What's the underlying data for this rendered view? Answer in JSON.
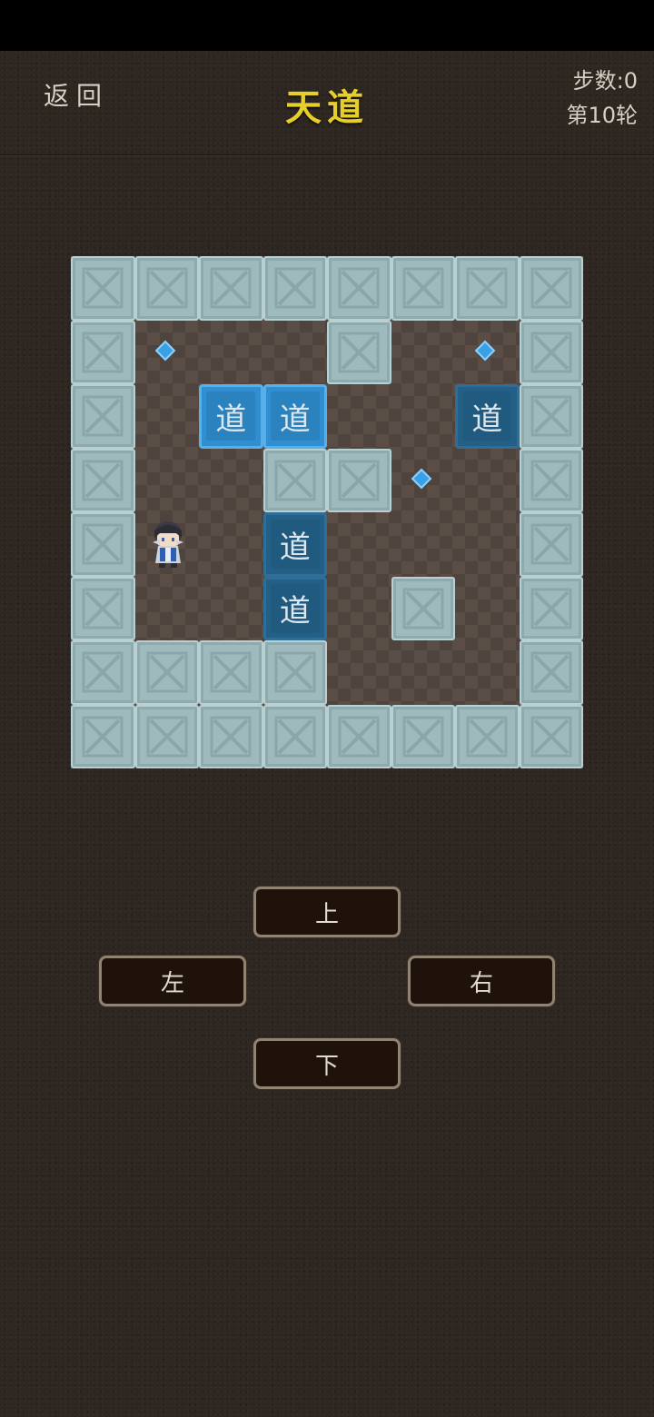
{
  "header": {
    "back_label": "返回",
    "title": "天道",
    "steps_label": "步数:0",
    "round_label": "第10轮"
  },
  "board": {
    "rows": 8,
    "cols": 8,
    "box_char": "道",
    "walls": [
      [
        0,
        0
      ],
      [
        0,
        1
      ],
      [
        0,
        2
      ],
      [
        0,
        3
      ],
      [
        0,
        4
      ],
      [
        0,
        5
      ],
      [
        0,
        6
      ],
      [
        0,
        7
      ],
      [
        1,
        0
      ],
      [
        1,
        4
      ],
      [
        1,
        7
      ],
      [
        2,
        0
      ],
      [
        2,
        7
      ],
      [
        3,
        0
      ],
      [
        3,
        3
      ],
      [
        3,
        4
      ],
      [
        3,
        7
      ],
      [
        4,
        0
      ],
      [
        4,
        7
      ],
      [
        5,
        0
      ],
      [
        5,
        5
      ],
      [
        5,
        7
      ],
      [
        6,
        0
      ],
      [
        6,
        1
      ],
      [
        6,
        2
      ],
      [
        6,
        3
      ],
      [
        6,
        7
      ],
      [
        7,
        0
      ],
      [
        7,
        1
      ],
      [
        7,
        2
      ],
      [
        7,
        3
      ],
      [
        7,
        4
      ],
      [
        7,
        5
      ],
      [
        7,
        6
      ],
      [
        7,
        7
      ]
    ],
    "boxes_free": [
      [
        2,
        2
      ],
      [
        2,
        3
      ]
    ],
    "boxes_on_target": [
      [
        2,
        6
      ],
      [
        4,
        3
      ],
      [
        5,
        3
      ]
    ],
    "targets": [
      [
        1,
        1
      ],
      [
        1,
        6
      ],
      [
        3,
        5
      ]
    ],
    "player": [
      4,
      1
    ]
  },
  "controls": {
    "up": "上",
    "left": "左",
    "right": "右",
    "down": "下"
  },
  "colors": {
    "title": "#e6cf2b",
    "wall": "#9fbabd",
    "box_free": "#2f8fd0",
    "box_on_target": "#235f86",
    "target": "#3aa0e6"
  }
}
